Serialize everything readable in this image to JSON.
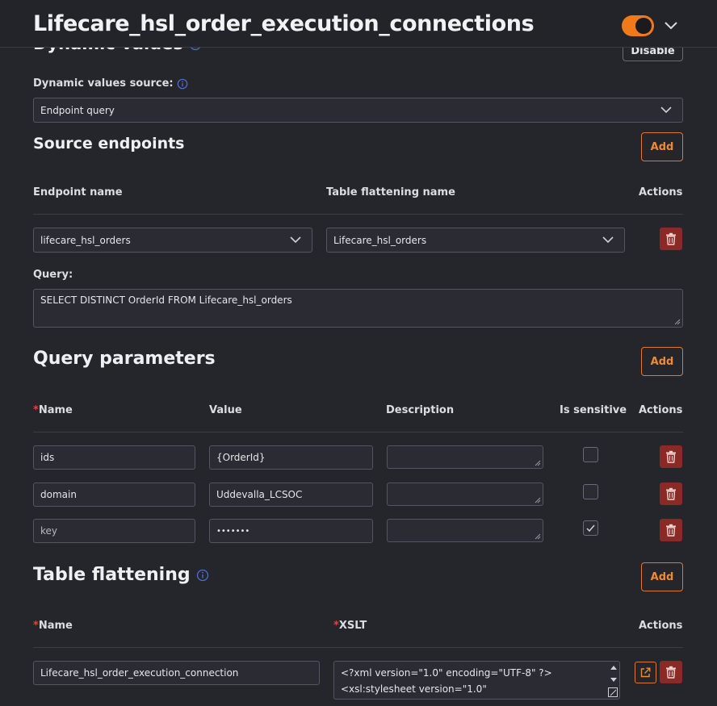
{
  "header": {
    "title": "Lifecare_hsl_order_execution_connections"
  },
  "dynamic_values": {
    "heading": "Dynamic values",
    "disable_label": "Disable",
    "source_label": "Dynamic values source:",
    "source_value": "Endpoint query"
  },
  "source_endpoints": {
    "title": "Source endpoints",
    "add_label": "Add",
    "columns": [
      "Endpoint name",
      "Table flattening name",
      "Actions"
    ],
    "row": {
      "endpoint": "lifecare_hsl_orders",
      "flattening": "Lifecare_hsl_orders"
    },
    "query_label": "Query:",
    "query_value": "SELECT DISTINCT OrderId FROM Lifecare_hsl_orders"
  },
  "query_parameters": {
    "title": "Query parameters",
    "add_label": "Add",
    "required_mark": "*",
    "columns": [
      "Name",
      "Value",
      "Description",
      "Is sensitive",
      "Actions"
    ],
    "rows": [
      {
        "name": "ids",
        "value": "{OrderId}",
        "description": "",
        "sensitive": false
      },
      {
        "name": "domain",
        "value": "Uddevalla_LCSOC",
        "description": "",
        "sensitive": false
      },
      {
        "name": "key",
        "value": "•••••••",
        "description": "",
        "sensitive": true
      }
    ]
  },
  "table_flattening": {
    "title": "Table flattening",
    "add_label": "Add",
    "required_mark": "*",
    "columns": [
      "Name",
      "XSLT",
      "Actions"
    ],
    "row": {
      "name": "Lifecare_hsl_order_execution_connection",
      "xslt_line1": "<?xml version=\"1.0\" encoding=\"UTF-8\" ?>",
      "xslt_line2": "<xsl:stylesheet version=\"1.0\""
    }
  },
  "colors": {
    "accent": "#f07a1a",
    "danger": "#8a2a26",
    "background": "#25252c",
    "info": "#4a6fd8"
  }
}
